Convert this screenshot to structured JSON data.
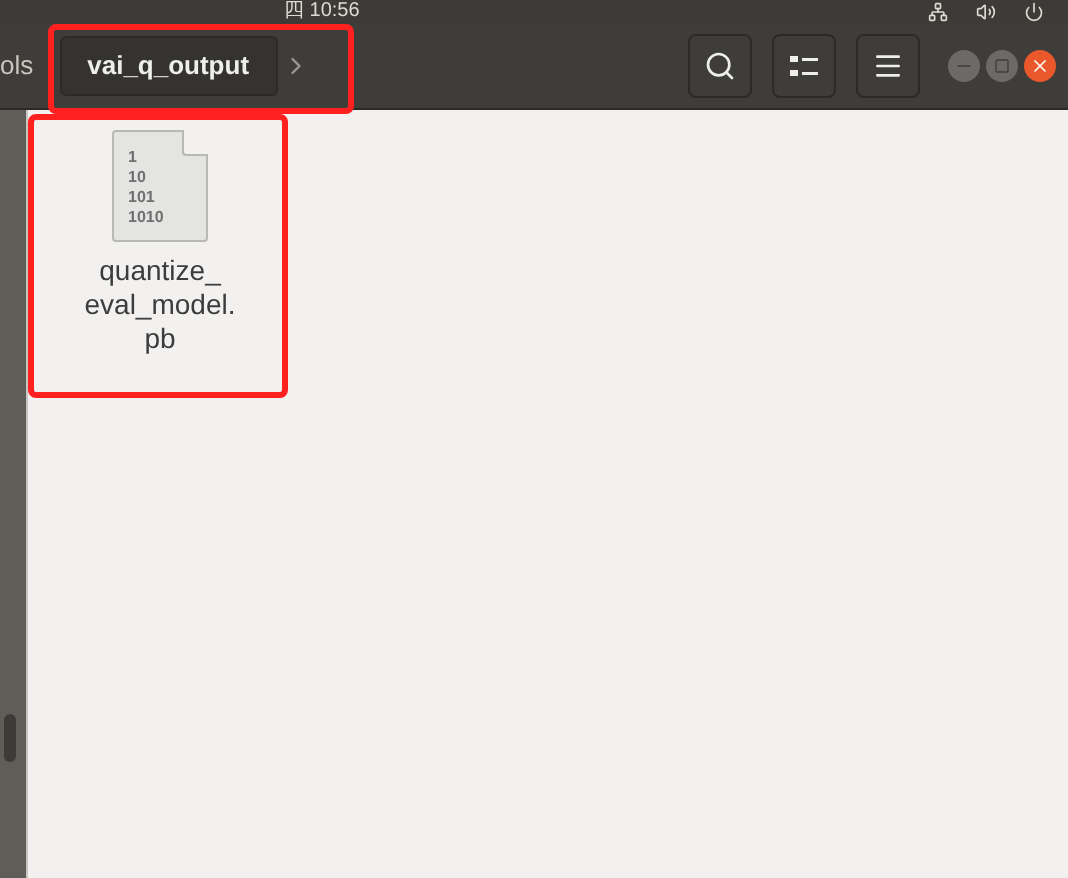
{
  "top_bar": {
    "clock": "四 10:56"
  },
  "path_bar": [
    {
      "label": "ols",
      "selected": false
    },
    {
      "label": "vai_q_output",
      "selected": true
    }
  ],
  "toolbar": [
    {
      "kind": "search"
    },
    {
      "kind": "view"
    },
    {
      "kind": "menu"
    }
  ],
  "files": [
    {
      "name": "quantize_\neval_model.\npb",
      "icon_lines": [
        "1",
        "10",
        "101",
        "1010"
      ]
    }
  ],
  "annotations": [
    {
      "kind": "box",
      "color": "#ff2020"
    },
    {
      "kind": "box",
      "color": "#ff2020"
    }
  ]
}
